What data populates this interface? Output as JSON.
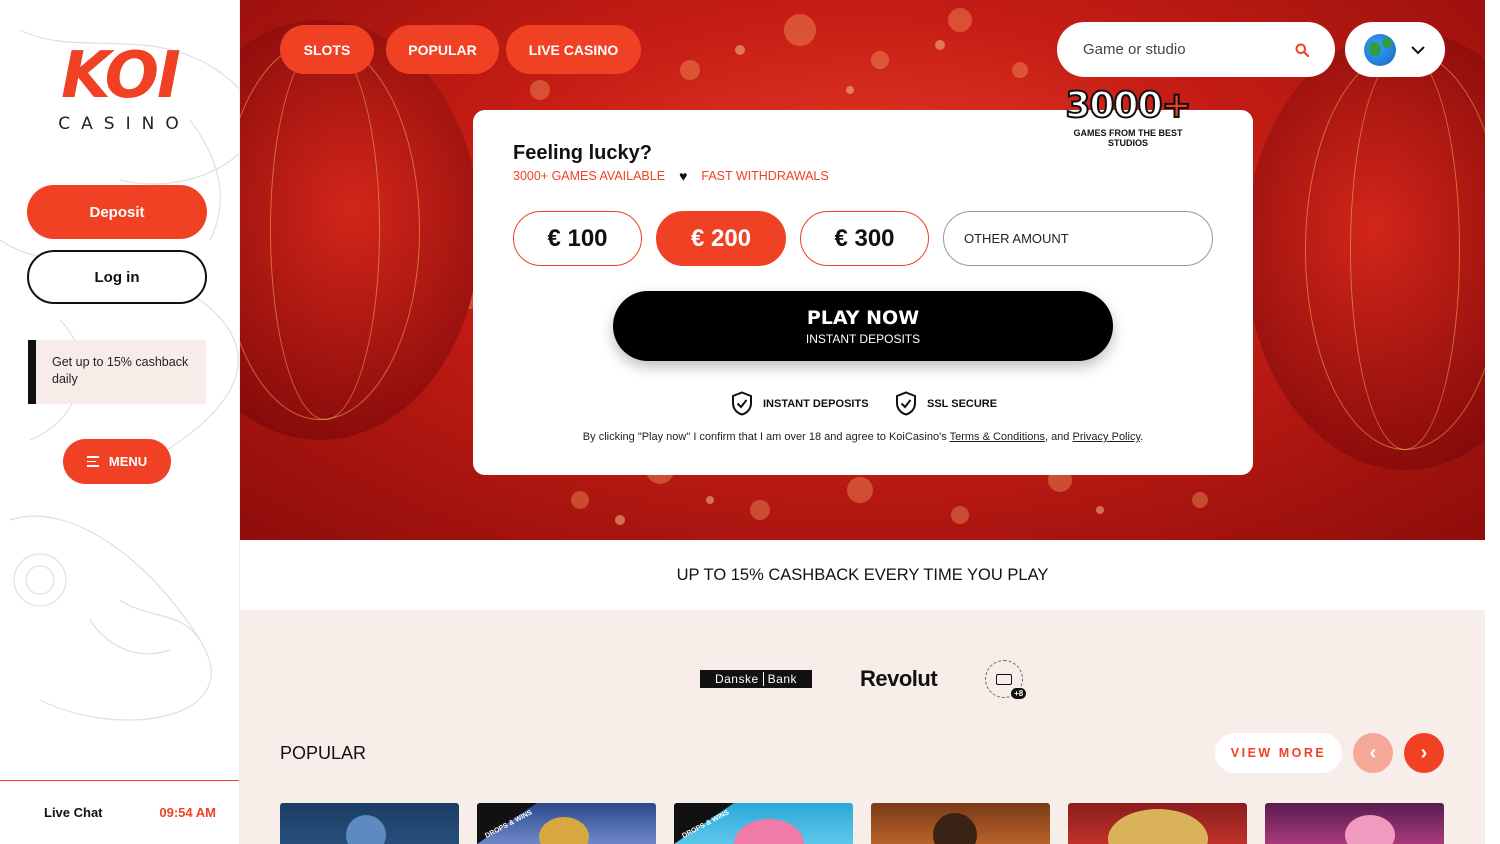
{
  "brand": {
    "logo_main": "KOI",
    "logo_sub": "CASINO",
    "accent": "#f04124"
  },
  "sidebar": {
    "deposit_label": "Deposit",
    "login_label": "Log in",
    "promo_text": "Get up to 15% cashback daily",
    "menu_label": "MENU",
    "live_chat_label": "Live Chat",
    "time": "09:54 AM"
  },
  "topnav": {
    "items": [
      {
        "label": "SLOTS"
      },
      {
        "label": "POPULAR"
      },
      {
        "label": "LIVE CASINO"
      }
    ],
    "search_placeholder": "Game or studio"
  },
  "deposit_card": {
    "badge_number": "3000",
    "badge_plus": "+",
    "badge_sub": "GAMES FROM THE BEST STUDIOS",
    "title": "Feeling lucky?",
    "games_available": "3000+ GAMES AVAILABLE",
    "fast_withdrawals": "FAST WITHDRAWALS",
    "amounts": [
      "€ 100",
      "€ 200",
      "€ 300"
    ],
    "selected_amount": "€ 200",
    "other_amount_label": "OTHER AMOUNT",
    "play_label": "PLAY NOW",
    "play_sub": "INSTANT DEPOSITS",
    "trust_1": "INSTANT DEPOSITS",
    "trust_2": "SSL SECURE",
    "legal_prefix": "By clicking \"Play now\" I confirm that I am over 18 and agree to KoiCasino's ",
    "terms_link": "Terms & Conditions",
    "legal_mid": ", and ",
    "privacy_link": "Privacy Policy",
    "legal_suffix": "."
  },
  "cashback_banner": "UP TO 15% CASHBACK EVERY TIME YOU PLAY",
  "payments": {
    "bank_1_a": "Danske",
    "bank_1_b": "Bank",
    "bank_2": "Revolut",
    "more_count": "+8"
  },
  "popular": {
    "title": "POPULAR",
    "view_more": "VIEW MORE",
    "prev_arrow": "‹",
    "next_arrow": "›",
    "drops_tag": "DROPS & WINS"
  }
}
